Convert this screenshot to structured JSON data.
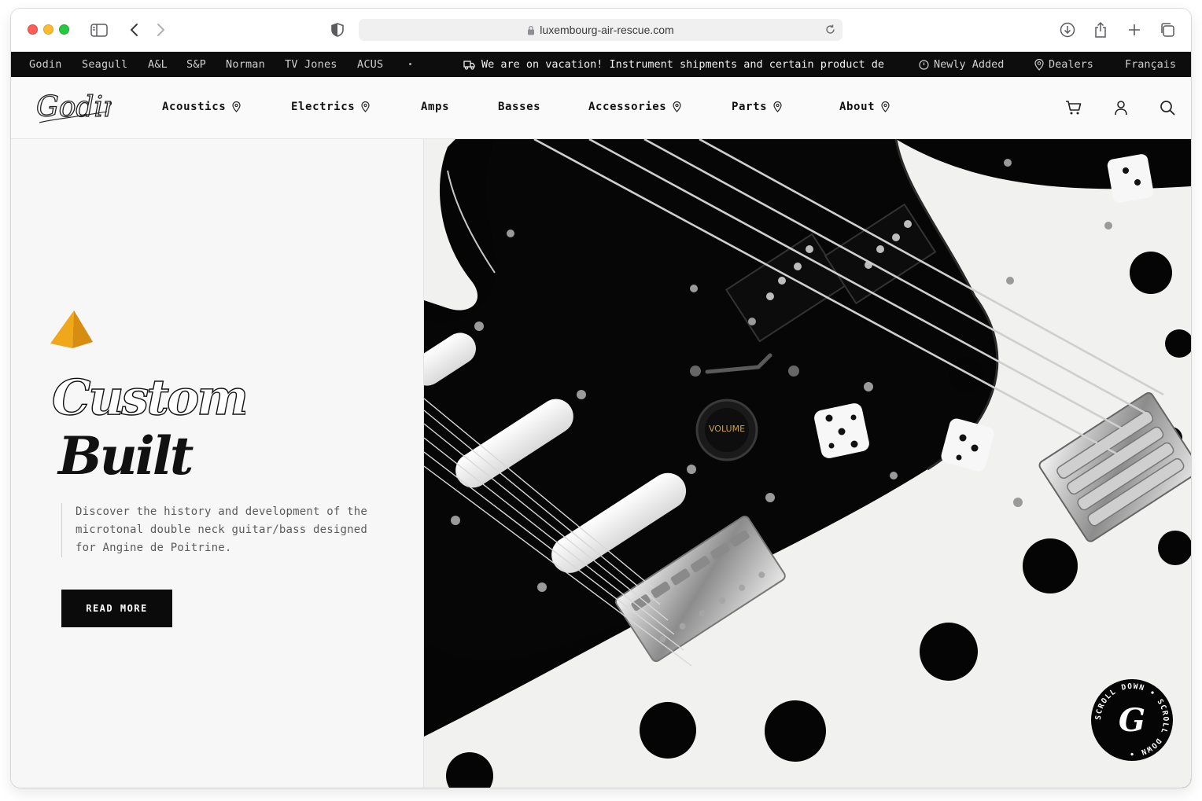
{
  "browser": {
    "url": "luxembourg-air-rescue.com"
  },
  "topbar": {
    "brands": [
      "Godin",
      "Seagull",
      "A&L",
      "S&P",
      "Norman",
      "TV Jones",
      "ACUS"
    ],
    "announcement": "We are on vacation! Instrument shipments and certain product de",
    "newly_added": "Newly Added",
    "dealers": "Dealers",
    "language": "Français"
  },
  "nav": {
    "logo_text": "Godin",
    "items": [
      "Acoustics",
      "Electrics",
      "Amps",
      "Basses",
      "Accessories",
      "Parts",
      "About"
    ]
  },
  "hero": {
    "title_outline": "Custom",
    "title_solid": "Built",
    "blurb": "Discover the history and development of the microtonal double neck guitar/bass designed for Angine de Poitrine.",
    "cta": "READ MORE",
    "knob_label": "VOLUME",
    "scroll_badge": "SCROLL DOWN • SCROLL DOWN •",
    "badge_letter": "G"
  },
  "colors": {
    "topbar_bg": "#0d0d0d",
    "pyramid": "#f0a81a",
    "cta_bg": "#0b0b0b"
  }
}
